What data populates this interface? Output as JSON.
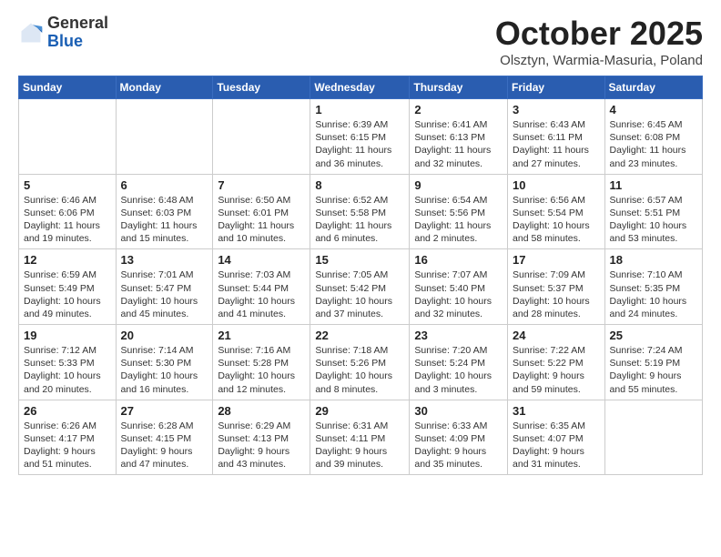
{
  "logo": {
    "general": "General",
    "blue": "Blue"
  },
  "title": "October 2025",
  "location": "Olsztyn, Warmia-Masuria, Poland",
  "days_of_week": [
    "Sunday",
    "Monday",
    "Tuesday",
    "Wednesday",
    "Thursday",
    "Friday",
    "Saturday"
  ],
  "weeks": [
    [
      {
        "day": "",
        "info": ""
      },
      {
        "day": "",
        "info": ""
      },
      {
        "day": "",
        "info": ""
      },
      {
        "day": "1",
        "info": "Sunrise: 6:39 AM\nSunset: 6:15 PM\nDaylight: 11 hours\nand 36 minutes."
      },
      {
        "day": "2",
        "info": "Sunrise: 6:41 AM\nSunset: 6:13 PM\nDaylight: 11 hours\nand 32 minutes."
      },
      {
        "day": "3",
        "info": "Sunrise: 6:43 AM\nSunset: 6:11 PM\nDaylight: 11 hours\nand 27 minutes."
      },
      {
        "day": "4",
        "info": "Sunrise: 6:45 AM\nSunset: 6:08 PM\nDaylight: 11 hours\nand 23 minutes."
      }
    ],
    [
      {
        "day": "5",
        "info": "Sunrise: 6:46 AM\nSunset: 6:06 PM\nDaylight: 11 hours\nand 19 minutes."
      },
      {
        "day": "6",
        "info": "Sunrise: 6:48 AM\nSunset: 6:03 PM\nDaylight: 11 hours\nand 15 minutes."
      },
      {
        "day": "7",
        "info": "Sunrise: 6:50 AM\nSunset: 6:01 PM\nDaylight: 11 hours\nand 10 minutes."
      },
      {
        "day": "8",
        "info": "Sunrise: 6:52 AM\nSunset: 5:58 PM\nDaylight: 11 hours\nand 6 minutes."
      },
      {
        "day": "9",
        "info": "Sunrise: 6:54 AM\nSunset: 5:56 PM\nDaylight: 11 hours\nand 2 minutes."
      },
      {
        "day": "10",
        "info": "Sunrise: 6:56 AM\nSunset: 5:54 PM\nDaylight: 10 hours\nand 58 minutes."
      },
      {
        "day": "11",
        "info": "Sunrise: 6:57 AM\nSunset: 5:51 PM\nDaylight: 10 hours\nand 53 minutes."
      }
    ],
    [
      {
        "day": "12",
        "info": "Sunrise: 6:59 AM\nSunset: 5:49 PM\nDaylight: 10 hours\nand 49 minutes."
      },
      {
        "day": "13",
        "info": "Sunrise: 7:01 AM\nSunset: 5:47 PM\nDaylight: 10 hours\nand 45 minutes."
      },
      {
        "day": "14",
        "info": "Sunrise: 7:03 AM\nSunset: 5:44 PM\nDaylight: 10 hours\nand 41 minutes."
      },
      {
        "day": "15",
        "info": "Sunrise: 7:05 AM\nSunset: 5:42 PM\nDaylight: 10 hours\nand 37 minutes."
      },
      {
        "day": "16",
        "info": "Sunrise: 7:07 AM\nSunset: 5:40 PM\nDaylight: 10 hours\nand 32 minutes."
      },
      {
        "day": "17",
        "info": "Sunrise: 7:09 AM\nSunset: 5:37 PM\nDaylight: 10 hours\nand 28 minutes."
      },
      {
        "day": "18",
        "info": "Sunrise: 7:10 AM\nSunset: 5:35 PM\nDaylight: 10 hours\nand 24 minutes."
      }
    ],
    [
      {
        "day": "19",
        "info": "Sunrise: 7:12 AM\nSunset: 5:33 PM\nDaylight: 10 hours\nand 20 minutes."
      },
      {
        "day": "20",
        "info": "Sunrise: 7:14 AM\nSunset: 5:30 PM\nDaylight: 10 hours\nand 16 minutes."
      },
      {
        "day": "21",
        "info": "Sunrise: 7:16 AM\nSunset: 5:28 PM\nDaylight: 10 hours\nand 12 minutes."
      },
      {
        "day": "22",
        "info": "Sunrise: 7:18 AM\nSunset: 5:26 PM\nDaylight: 10 hours\nand 8 minutes."
      },
      {
        "day": "23",
        "info": "Sunrise: 7:20 AM\nSunset: 5:24 PM\nDaylight: 10 hours\nand 3 minutes."
      },
      {
        "day": "24",
        "info": "Sunrise: 7:22 AM\nSunset: 5:22 PM\nDaylight: 9 hours\nand 59 minutes."
      },
      {
        "day": "25",
        "info": "Sunrise: 7:24 AM\nSunset: 5:19 PM\nDaylight: 9 hours\nand 55 minutes."
      }
    ],
    [
      {
        "day": "26",
        "info": "Sunrise: 6:26 AM\nSunset: 4:17 PM\nDaylight: 9 hours\nand 51 minutes."
      },
      {
        "day": "27",
        "info": "Sunrise: 6:28 AM\nSunset: 4:15 PM\nDaylight: 9 hours\nand 47 minutes."
      },
      {
        "day": "28",
        "info": "Sunrise: 6:29 AM\nSunset: 4:13 PM\nDaylight: 9 hours\nand 43 minutes."
      },
      {
        "day": "29",
        "info": "Sunrise: 6:31 AM\nSunset: 4:11 PM\nDaylight: 9 hours\nand 39 minutes."
      },
      {
        "day": "30",
        "info": "Sunrise: 6:33 AM\nSunset: 4:09 PM\nDaylight: 9 hours\nand 35 minutes."
      },
      {
        "day": "31",
        "info": "Sunrise: 6:35 AM\nSunset: 4:07 PM\nDaylight: 9 hours\nand 31 minutes."
      },
      {
        "day": "",
        "info": ""
      }
    ]
  ]
}
